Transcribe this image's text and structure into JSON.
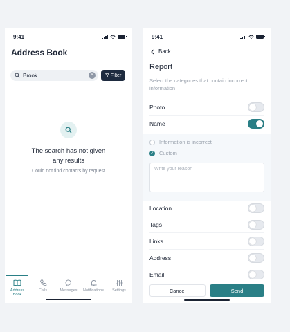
{
  "colors": {
    "accent": "#2a7f86",
    "dark_button": "#1e2b3f",
    "background": "#f1f3f6"
  },
  "left_screen": {
    "status_time": "9:41",
    "title": "Address Book",
    "search": {
      "value": "Brook",
      "icon": "search-icon",
      "clear_icon": "close-icon"
    },
    "filter_label": "Filter",
    "empty_state": {
      "icon": "search-icon",
      "title_line1": "The search has not given",
      "title_line2": "any results",
      "subtitle": "Could not find contacts by request"
    },
    "tabs": [
      {
        "line1": "Address",
        "line2": "Book",
        "icon": "book-icon",
        "active": true
      },
      {
        "line1": "Calls",
        "line2": "",
        "icon": "phone-icon",
        "active": false
      },
      {
        "line1": "Messages",
        "line2": "",
        "icon": "message-icon",
        "active": false
      },
      {
        "line1": "Notifications",
        "line2": "",
        "icon": "bell-icon",
        "active": false
      },
      {
        "line1": "Settings",
        "line2": "",
        "icon": "sliders-icon",
        "active": false
      }
    ]
  },
  "right_screen": {
    "status_time": "9:41",
    "back_label": "Back",
    "title": "Report",
    "subtitle": "Select the categories that contain incorrect information",
    "categories": [
      {
        "label": "Photo",
        "enabled": false
      },
      {
        "label": "Name",
        "enabled": true
      },
      {
        "label": "Location",
        "enabled": false
      },
      {
        "label": "Tags",
        "enabled": false
      },
      {
        "label": "Links",
        "enabled": false
      },
      {
        "label": "Address",
        "enabled": false
      },
      {
        "label": "Email",
        "enabled": false
      }
    ],
    "name_options": [
      {
        "label": "Information is incorrect",
        "selected": false
      },
      {
        "label": "Custom",
        "selected": true
      }
    ],
    "reason_placeholder": "Write your reason",
    "cancel_label": "Cancel",
    "send_label": "Send"
  }
}
